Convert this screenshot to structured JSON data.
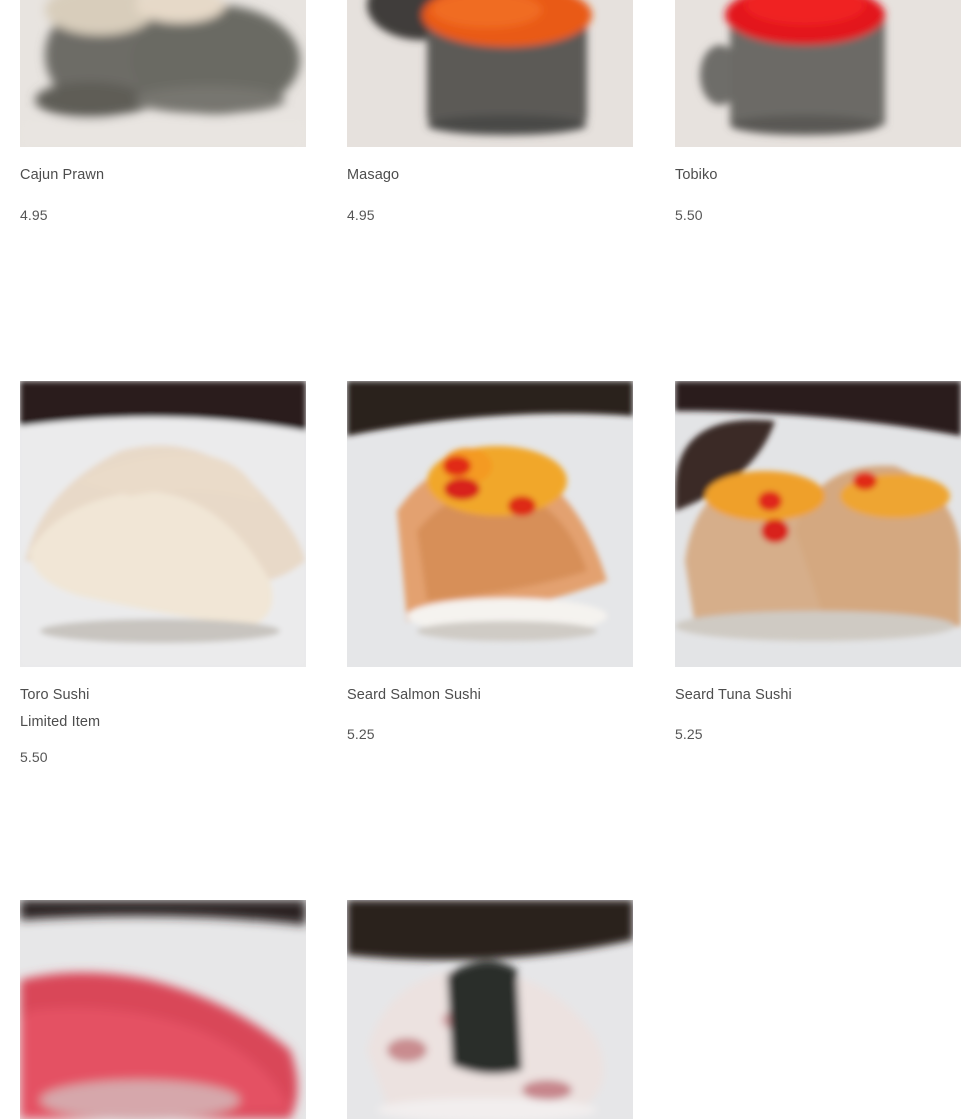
{
  "menu_items": [
    {
      "name": "Cajun Prawn",
      "price": "4.95",
      "image": "cajun-prawn-photo"
    },
    {
      "name": "Masago",
      "price": "4.95",
      "image": "masago-photo"
    },
    {
      "name": "Tobiko",
      "price": "5.50",
      "image": "tobiko-photo"
    },
    {
      "name": "Toro Sushi",
      "note": "Limited Item",
      "price": "5.50",
      "image": "toro-sushi-photo"
    },
    {
      "name": "Seard Salmon Sushi",
      "price": "5.25",
      "image": "seard-salmon-sushi-photo"
    },
    {
      "name": "Seard Tuna Sushi",
      "price": "5.25",
      "image": "seard-tuna-sushi-photo"
    },
    {
      "name": "",
      "image": "tuna-sushi-photo"
    },
    {
      "name": "",
      "image": "octopus-sushi-photo"
    }
  ]
}
